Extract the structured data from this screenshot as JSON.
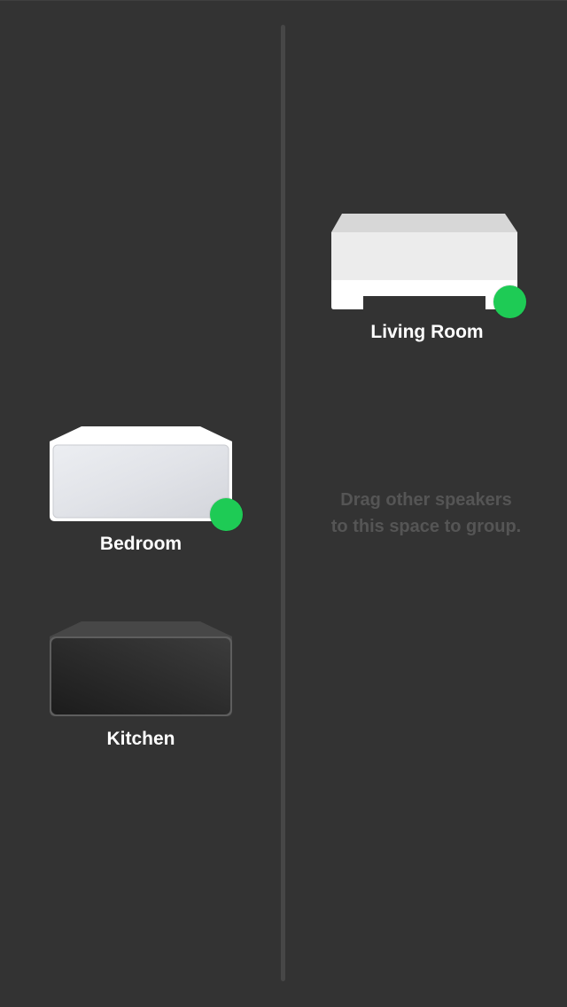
{
  "speakers": {
    "bedroom": {
      "name": "Bedroom",
      "status": "connected",
      "status_color": "#1ecb55"
    },
    "kitchen": {
      "name": "Kitchen"
    },
    "living_room": {
      "name": "Living Room",
      "status": "connected",
      "status_color": "#1ecb55"
    }
  },
  "group_area": {
    "hint_line1": "Drag other speakers",
    "hint_line2": "to this space to group."
  },
  "icons": {
    "bedroom": "speaker-white-icon",
    "kitchen": "speaker-black-icon",
    "living_room": "bridge-device-icon"
  },
  "colors": {
    "background": "#333333",
    "divider": "#474747",
    "status_green": "#1ecb55",
    "hint_text": "#555555"
  }
}
